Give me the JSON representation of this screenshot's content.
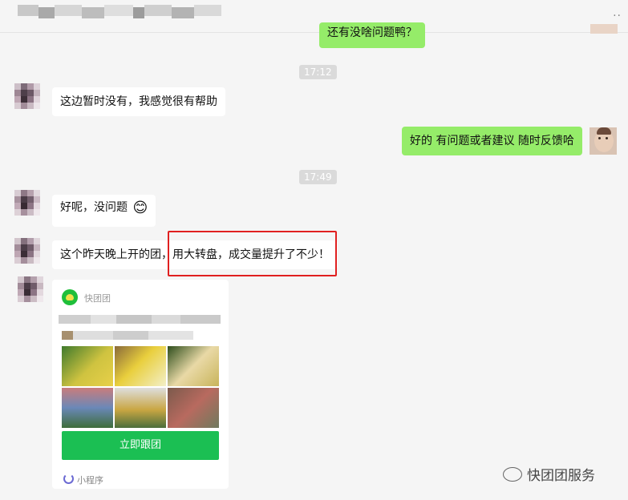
{
  "header": {
    "more_label": "··"
  },
  "messages": [
    {
      "id": "m0",
      "side": "right",
      "text": "还有没啥问题鸭？"
    },
    {
      "id": "ts1",
      "type": "timestamp",
      "text": "17:12"
    },
    {
      "id": "m1",
      "side": "left",
      "text": "这边暂时没有，我感觉很有帮助"
    },
    {
      "id": "m2",
      "side": "right",
      "text": "好的 有问题或者建议 随时反馈哈"
    },
    {
      "id": "ts2",
      "type": "timestamp",
      "text": "17:49"
    },
    {
      "id": "m3",
      "side": "left",
      "text": "好呢，没问题",
      "emoji": "😊"
    },
    {
      "id": "m4",
      "side": "left",
      "text": "这个昨天晚上开的团，用大转盘，成交量提升了不少！"
    }
  ],
  "mini_program_card": {
    "app_name": "快团团",
    "button_label": "立即跟团",
    "footer_label": "小程序"
  },
  "watermark": {
    "text": "快团团服务"
  },
  "colors": {
    "green_bubble": "#95ec69",
    "join_button": "#1bbf53",
    "highlight": "#e02020"
  }
}
